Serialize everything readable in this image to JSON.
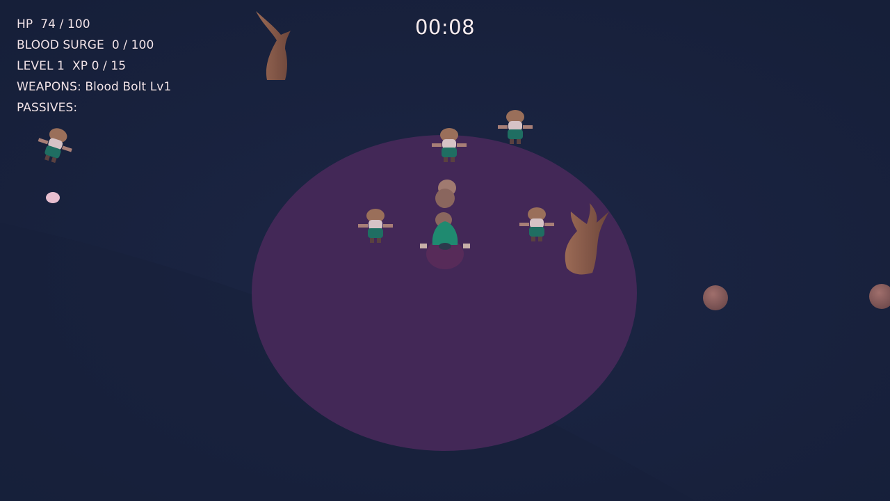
{
  "hud": {
    "hp_label": "HP",
    "hp_value": "74 / 100",
    "blood_surge_label": "BLOOD SURGE",
    "blood_surge_value": "0 / 100",
    "level_text": "LEVEL 1",
    "xp_text": "XP 0 / 15",
    "weapons_label": "WEAPONS:",
    "weapons_value": "Blood Bolt Lv1",
    "passives_label": "PASSIVES:",
    "passives_value": ""
  },
  "timer": "00:08",
  "colors": {
    "background": "#1a2340",
    "aura": "#452958",
    "hud_text": "#f2e4ea",
    "hero_cloak": "#1f8a70",
    "tree": "#8a5a4a",
    "rock": "#8a5d5d"
  },
  "scene": {
    "player": {
      "icon": "hooded-hero-icon"
    },
    "aura": {
      "icon": "blood-aura-circle"
    },
    "enemies": [
      {
        "icon": "zombie-kid-icon"
      },
      {
        "icon": "zombie-kid-icon"
      },
      {
        "icon": "zombie-kid-icon"
      },
      {
        "icon": "zombie-kid-icon"
      },
      {
        "icon": "zombie-kid-icon"
      },
      {
        "icon": "zombie-kid-icon"
      }
    ],
    "trees": [
      {
        "icon": "dead-tree-icon"
      },
      {
        "icon": "dead-tree-icon"
      }
    ],
    "rocks": [
      {
        "icon": "rock-icon"
      },
      {
        "icon": "rock-icon"
      }
    ],
    "projectiles": [
      {
        "icon": "blood-bolt-icon"
      },
      {
        "icon": "blood-bolt-icon"
      }
    ],
    "xp_gem": {
      "icon": "xp-orb-icon"
    }
  }
}
